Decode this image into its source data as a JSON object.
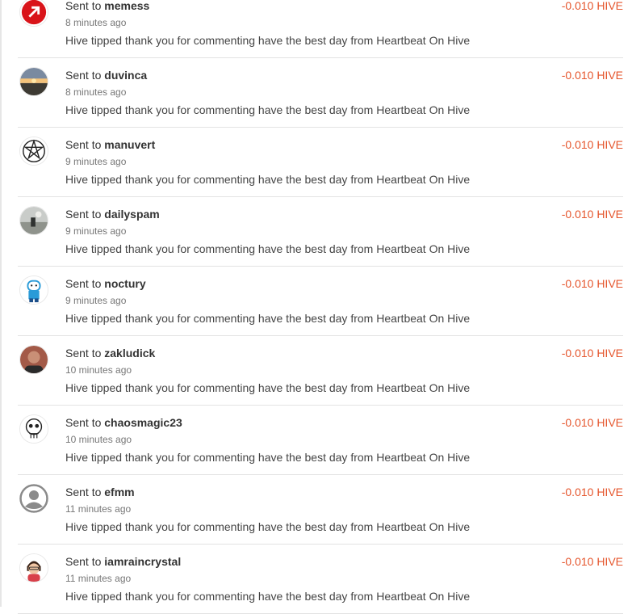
{
  "colors": {
    "amount": "#e5552c",
    "divider": "#e3e3e3"
  },
  "transfers": [
    {
      "prefix": "Sent to",
      "recipient": "memess",
      "time": "8 minutes ago",
      "memo": "Hive tipped thank you for commenting have the best day from Heartbeat On Hive",
      "amount": "-0.010 HIVE",
      "avatar_icon": "red-logo-icon"
    },
    {
      "prefix": "Sent to",
      "recipient": "duvinca",
      "time": "8 minutes ago",
      "memo": "Hive tipped thank you for commenting have the best day from Heartbeat On Hive",
      "amount": "-0.010 HIVE",
      "avatar_icon": "sunset-photo-icon"
    },
    {
      "prefix": "Sent to",
      "recipient": "manuvert",
      "time": "9 minutes ago",
      "memo": "Hive tipped thank you for commenting have the best day from Heartbeat On Hive",
      "amount": "-0.010 HIVE",
      "avatar_icon": "pentagram-icon"
    },
    {
      "prefix": "Sent to",
      "recipient": "dailyspam",
      "time": "9 minutes ago",
      "memo": "Hive tipped thank you for commenting have the best day from Heartbeat On Hive",
      "amount": "-0.010 HIVE",
      "avatar_icon": "landscape-photo-icon"
    },
    {
      "prefix": "Sent to",
      "recipient": "noctury",
      "time": "9 minutes ago",
      "memo": "Hive tipped thank you for commenting have the best day from Heartbeat On Hive",
      "amount": "-0.010 HIVE",
      "avatar_icon": "cartoon-character-icon"
    },
    {
      "prefix": "Sent to",
      "recipient": "zakludick",
      "time": "10 minutes ago",
      "memo": "Hive tipped thank you for commenting have the best day from Heartbeat On Hive",
      "amount": "-0.010 HIVE",
      "avatar_icon": "person-photo-icon"
    },
    {
      "prefix": "Sent to",
      "recipient": "chaosmagic23",
      "time": "10 minutes ago",
      "memo": "Hive tipped thank you for commenting have the best day from Heartbeat On Hive",
      "amount": "-0.010 HIVE",
      "avatar_icon": "skull-drawing-icon"
    },
    {
      "prefix": "Sent to",
      "recipient": "efmm",
      "time": "11 minutes ago",
      "memo": "Hive tipped thank you for commenting have the best day from Heartbeat On Hive",
      "amount": "-0.010 HIVE",
      "avatar_icon": "default-user-icon"
    },
    {
      "prefix": "Sent to",
      "recipient": "iamraincrystal",
      "time": "11 minutes ago",
      "memo": "Hive tipped thank you for commenting have the best day from Heartbeat On Hive",
      "amount": "-0.010 HIVE",
      "avatar_icon": "cartoon-avatar-icon"
    }
  ]
}
